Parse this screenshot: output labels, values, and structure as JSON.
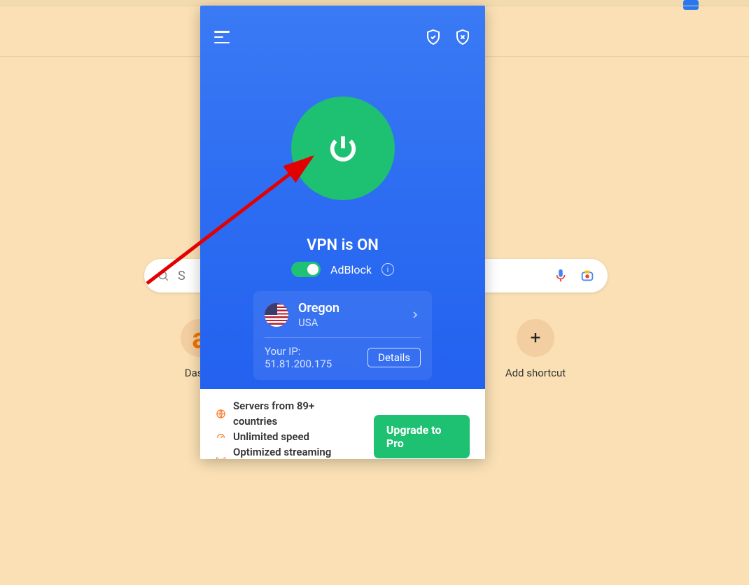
{
  "background": {
    "search_placeholder_visible": "S",
    "shortcut_a_label": "Dashb",
    "shortcut_a_letter": "a",
    "shortcut_b_label": "Add shortcut"
  },
  "vpn": {
    "status": "VPN is ON",
    "adblock_label": "AdBlock",
    "adblock_enabled": true,
    "location": {
      "region": "Oregon",
      "country": "USA"
    },
    "ip_label": "Your IP: 51.81.200.175",
    "details_button": "Details"
  },
  "footer": {
    "features": [
      "Servers from 89+ countries",
      "Unlimited speed",
      "Optimized streaming servers"
    ],
    "upgrade_button": "Upgrade to Pro"
  },
  "icons": {
    "menu": "menu-icon",
    "shield_check": "shield-check-icon",
    "shield_x": "shield-x-icon",
    "power": "power-icon",
    "info": "info-icon",
    "chevron": "chevron-right-icon",
    "mic": "mic-icon",
    "camera": "camera-search-icon",
    "plus": "plus-icon",
    "globe": "globe-icon",
    "speed": "speed-icon",
    "signal": "signal-icon"
  },
  "colors": {
    "accent_green": "#1dc171",
    "panel_blue": "#2e6ef2",
    "page_bg": "#fae0b4"
  }
}
